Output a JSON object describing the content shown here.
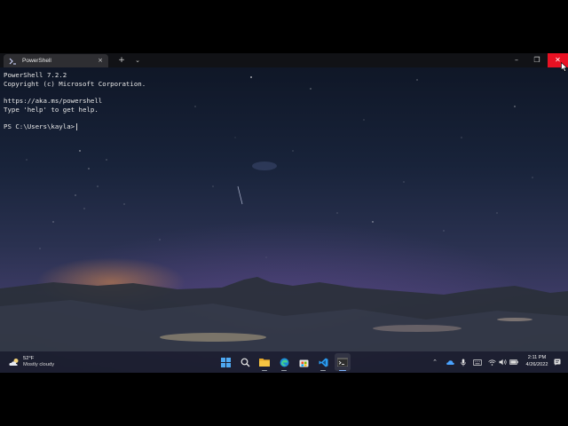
{
  "terminal": {
    "tab_title": "PowerShell",
    "close_tab_glyph": "×",
    "new_tab_glyph": "+",
    "dropdown_glyph": "⌄",
    "minimize_glyph": "–",
    "maximize_glyph": "❐",
    "close_glyph": "✕",
    "lines": [
      "PowerShell 7.2.2",
      "Copyright (c) Microsoft Corporation.",
      "",
      "https://aka.ms/powershell",
      "Type 'help' to get help.",
      "",
      "PS C:\\Users\\kayla>"
    ]
  },
  "taskbar": {
    "weather": {
      "temp": "52°F",
      "condition": "Mostly cloudy",
      "icon": "cloud-moon-icon"
    },
    "apps": [
      {
        "name": "start",
        "icon": "windows-logo-icon"
      },
      {
        "name": "search",
        "icon": "search-icon"
      },
      {
        "name": "file-explorer",
        "icon": "folder-icon"
      },
      {
        "name": "edge",
        "icon": "edge-icon"
      },
      {
        "name": "store",
        "icon": "store-icon"
      },
      {
        "name": "vscode",
        "icon": "vscode-icon"
      },
      {
        "name": "terminal",
        "icon": "terminal-icon",
        "active": true
      }
    ],
    "tray": {
      "overflow_glyph": "⌃",
      "icons": [
        "onedrive-icon",
        "microphone-icon",
        "keyboard-icon",
        "wifi-icon",
        "volume-icon",
        "battery-icon"
      ]
    },
    "clock": {
      "time": "2:11 PM",
      "date": "4/26/2022"
    }
  },
  "colors": {
    "close_button": "#e81123",
    "taskbar": "#1c1e30",
    "terminal_text": "#e6e6e6",
    "active_indicator": "#7fb6ff"
  }
}
